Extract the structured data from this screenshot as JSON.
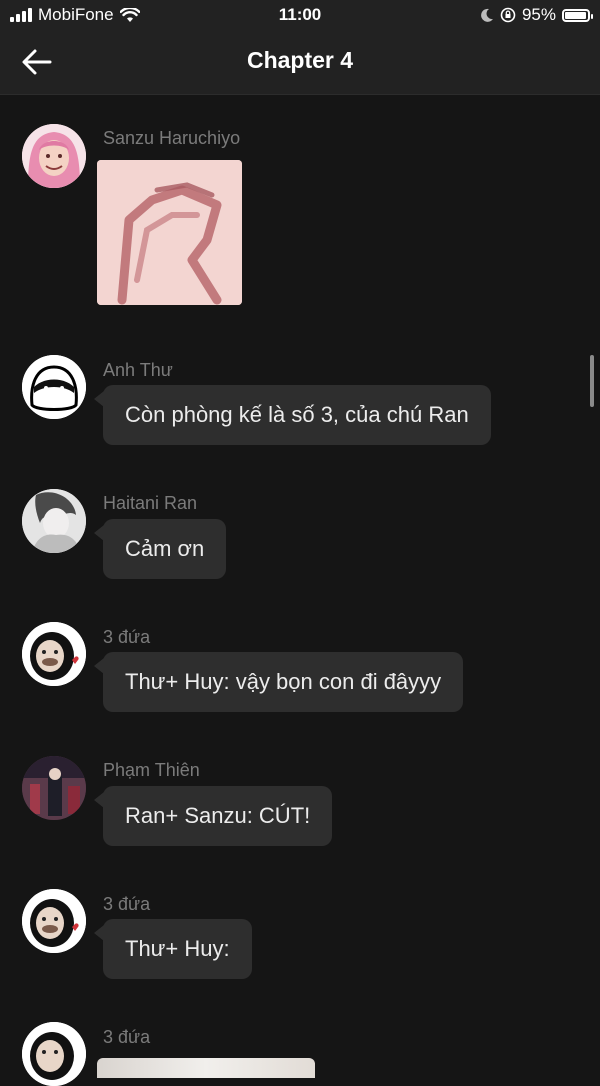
{
  "status": {
    "carrier": "MobiFone",
    "time": "11:00",
    "battery_percent": 95,
    "battery_label": "95%"
  },
  "header": {
    "title": "Chapter 4",
    "back_icon": "arrow-left-icon"
  },
  "colors": {
    "background": "#151515",
    "bars": "#222222",
    "bubble": "#2e2e2e",
    "sender_name": "#7b7b7b"
  },
  "messages": [
    {
      "sender": "Sanzu Haruchiyo",
      "type": "image"
    },
    {
      "sender": "Anh Thư",
      "text": "Còn phòng kế là số 3, của chú Ran"
    },
    {
      "sender": "Haitani Ran",
      "text": "Cảm ơn"
    },
    {
      "sender": "3 đứa",
      "text": "Thư+ Huy: vậy bọn con đi đâyyy"
    },
    {
      "sender": "Phạm Thiên",
      "text": "Ran+ Sanzu: CÚT!"
    },
    {
      "sender": "3 đứa",
      "text": "Thư+ Huy:"
    },
    {
      "sender": "3 đứa",
      "type": "image"
    }
  ]
}
